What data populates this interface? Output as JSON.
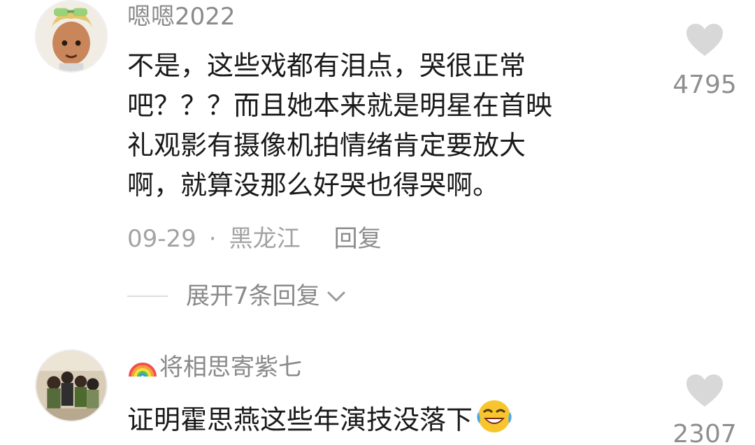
{
  "comments": [
    {
      "username": "嗯嗯2022",
      "avatar": "cartoon-boy-avatar",
      "text_lines": [
        "不是，这些戏都有泪点，哭很正常",
        "吧？？？而且她本来就是明星在首映",
        "礼观影有摄像机拍情绪肯定要放大",
        "啊，就算没那么好哭也得哭啊。"
      ],
      "date": "09-29",
      "separator": "·",
      "location": "黑龙江",
      "reply_label": "回复",
      "expand_replies_label": "展开7条回复",
      "like_icon": "heart-icon",
      "like_count": "4795"
    },
    {
      "username_badge": "rainbow-icon",
      "username": "将相思寄紫七",
      "avatar": "group-photo-avatar",
      "text": "证明霍思燕这些年演技没落下",
      "emoji": "rolling-laughing-emoji",
      "like_icon": "heart-icon",
      "like_count": "2307"
    }
  ],
  "colors": {
    "username": "#8a8a8a",
    "body_text": "#1a1a1a",
    "meta_text": "#a3a3a3",
    "like_icon": "#d8d8d8"
  }
}
